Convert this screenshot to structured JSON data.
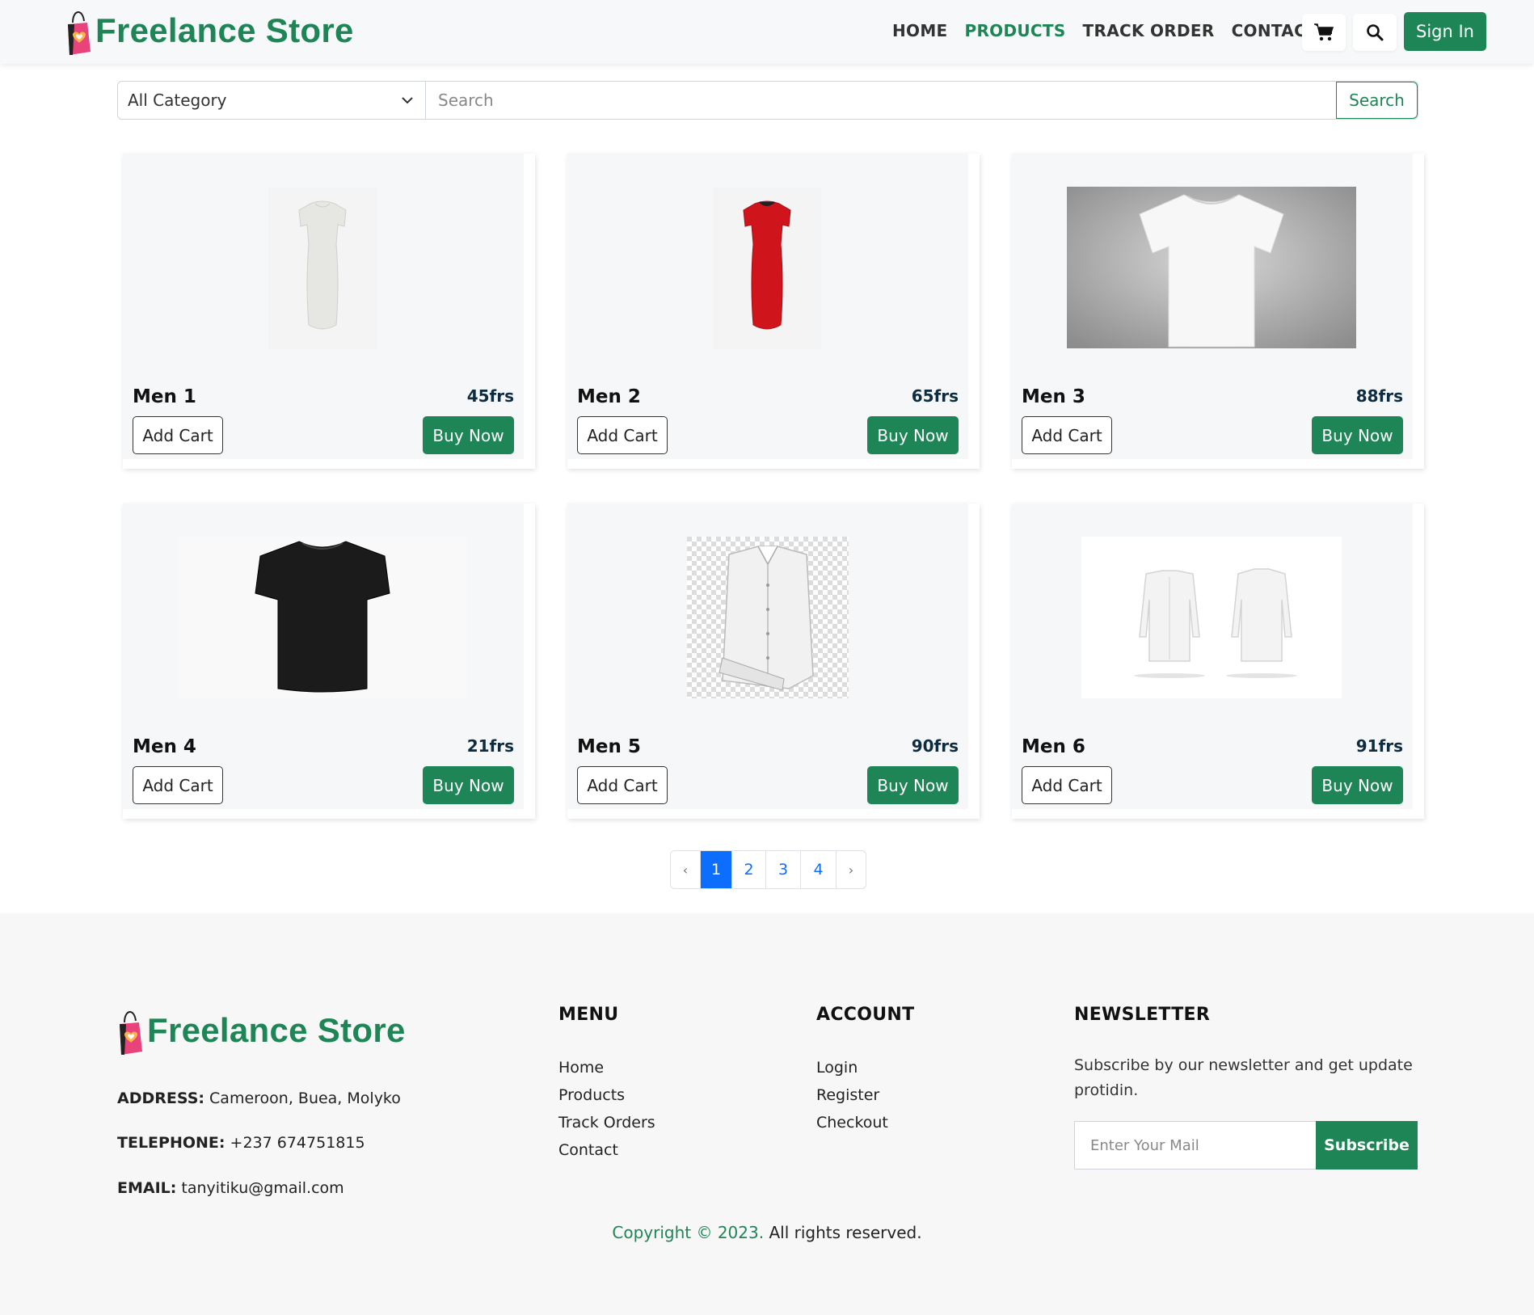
{
  "brand": {
    "name": "Freelance Store",
    "color": "#1e8556"
  },
  "nav": {
    "links": [
      {
        "label": "HOME",
        "active": false
      },
      {
        "label": "PRODUCTS",
        "active": true
      },
      {
        "label": "TRACK ORDER",
        "active": false
      },
      {
        "label": "CONTACT",
        "active": false
      }
    ],
    "cart_icon": "cart-icon",
    "search_icon": "search-icon",
    "signin_label": "Sign In"
  },
  "search": {
    "category_selected": "All Category",
    "placeholder": "Search",
    "button_label": "Search"
  },
  "products": [
    {
      "name": "Men 1",
      "price": "45frs",
      "image": "white-dress",
      "add_label": "Add Cart",
      "buy_label": "Buy Now"
    },
    {
      "name": "Men 2",
      "price": "65frs",
      "image": "red-dress",
      "add_label": "Add Cart",
      "buy_label": "Buy Now"
    },
    {
      "name": "Men 3",
      "price": "88frs",
      "image": "white-tshirt",
      "add_label": "Add Cart",
      "buy_label": "Buy Now"
    },
    {
      "name": "Men 4",
      "price": "21frs",
      "image": "black-tshirt",
      "add_label": "Add Cart",
      "buy_label": "Buy Now"
    },
    {
      "name": "Men 5",
      "price": "90frs",
      "image": "white-dress-shirt",
      "add_label": "Add Cart",
      "buy_label": "Buy Now"
    },
    {
      "name": "Men 6",
      "price": "91frs",
      "image": "white-long-sleeve-shirts",
      "add_label": "Add Cart",
      "buy_label": "Buy Now"
    }
  ],
  "pagination": {
    "prev": "‹",
    "pages": [
      "1",
      "2",
      "3",
      "4"
    ],
    "current": "1",
    "next": "›"
  },
  "footer": {
    "brand": "Freelance Store",
    "address_label": "ADDRESS:",
    "address": "Cameroon, Buea, Molyko",
    "telephone_label": "TELEPHONE:",
    "telephone": "+237 674751815",
    "email_label": "EMAIL:",
    "email": "tanyitiku@gmail.com",
    "menu": {
      "heading": "MENU",
      "items": [
        "Home",
        "Products",
        "Track Orders",
        "Contact"
      ]
    },
    "account": {
      "heading": "ACCOUNT",
      "items": [
        "Login",
        "Register",
        "Checkout"
      ]
    },
    "newsletter": {
      "heading": "NEWSLETTER",
      "text": "Subscribe by our newsletter and get update protidin.",
      "placeholder": "Enter Your Mail",
      "button_label": "Subscribe"
    },
    "copyright_green": "Copyright © 2023.",
    "copyright_rest": " All rights reserved."
  }
}
